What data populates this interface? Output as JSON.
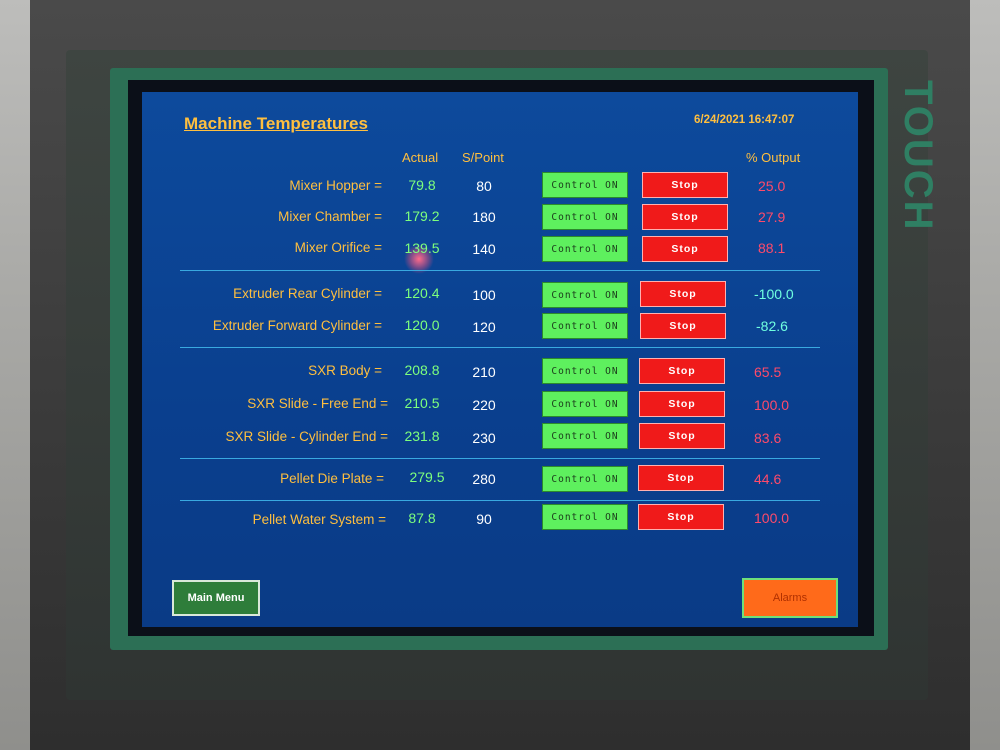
{
  "screen": {
    "title": "Machine Temperatures",
    "datetime": "6/24/2021 16:47:07",
    "brand": "TOUCH"
  },
  "headers": {
    "actual": "Actual",
    "setpoint": "S/Point",
    "output": "% Output"
  },
  "rows": [
    {
      "label": "Mixer Hopper =",
      "actual": "79.8",
      "setpoint": "80",
      "control": "Control ON",
      "stop": "Stop",
      "output": "25.0",
      "output_color": "red"
    },
    {
      "label": "Mixer Chamber =",
      "actual": "179.2",
      "setpoint": "180",
      "control": "Control ON",
      "stop": "Stop",
      "output": "27.9",
      "output_color": "red"
    },
    {
      "label": "Mixer Orifice =",
      "actual": "139.5",
      "setpoint": "140",
      "control": "Control ON",
      "stop": "Stop",
      "output": "88.1",
      "output_color": "red"
    },
    {
      "label": "Extruder Rear Cylinder =",
      "actual": "120.4",
      "setpoint": "100",
      "control": "Control ON",
      "stop": "Stop",
      "output": "-100.0",
      "output_color": "cyan"
    },
    {
      "label": "Extruder Forward Cylinder =",
      "actual": "120.0",
      "setpoint": "120",
      "control": "Control ON",
      "stop": "Stop",
      "output": "-82.6",
      "output_color": "cyan"
    },
    {
      "label": "SXR Body =",
      "actual": "208.8",
      "setpoint": "210",
      "control": "Control ON",
      "stop": "Stop",
      "output": "65.5",
      "output_color": "red"
    },
    {
      "label": "SXR Slide - Free End =",
      "actual": "210.5",
      "setpoint": "220",
      "control": "Control ON",
      "stop": "Stop",
      "output": "100.0",
      "output_color": "red"
    },
    {
      "label": "SXR Slide - Cylinder End =",
      "actual": "231.8",
      "setpoint": "230",
      "control": "Control ON",
      "stop": "Stop",
      "output": "83.6",
      "output_color": "red"
    },
    {
      "label": "Pellet Die Plate =",
      "actual": "279.5",
      "setpoint": "280",
      "control": "Control ON",
      "stop": "Stop",
      "output": "44.6",
      "output_color": "red"
    },
    {
      "label": "Pellet Water System =",
      "actual": "87.8",
      "setpoint": "90",
      "control": "Control ON",
      "stop": "Stop",
      "output": "100.0",
      "output_color": "red"
    }
  ],
  "footer": {
    "main_menu": "Main Menu",
    "alarms": "Alarms"
  }
}
